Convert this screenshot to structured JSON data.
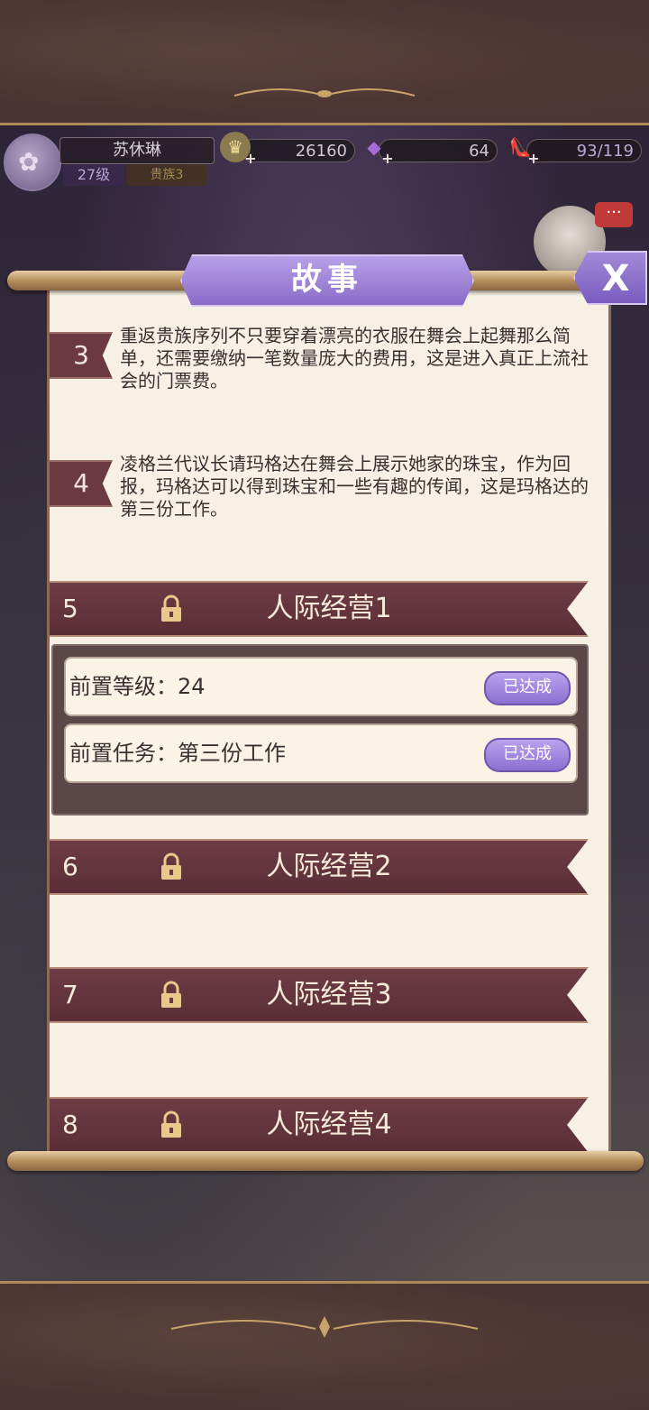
{
  "hud": {
    "player_name": "苏休琳",
    "level": "27级",
    "rank": "贵族3",
    "gold": "26160",
    "diamonds": "64",
    "stamina": "93/119"
  },
  "dialog": {
    "title": "故事",
    "close_label": "X"
  },
  "stories": [
    {
      "number": "3",
      "text": "重返贵族序列不只要穿着漂亮的衣服在舞会上起舞那么简单，还需要缴纳一笔数量庞大的费用，这是进入真正上流社会的门票费。"
    },
    {
      "number": "4",
      "text": "凌格兰代议长请玛格达在舞会上展示她家的珠宝，作为回报，玛格达可以得到珠宝和一些有趣的传闻，这是玛格达的第三份工作。"
    }
  ],
  "chapters": [
    {
      "number": "5",
      "title": "人际经营1",
      "locked": true
    },
    {
      "number": "6",
      "title": "人际经营2",
      "locked": true
    },
    {
      "number": "7",
      "title": "人际经营3",
      "locked": true
    },
    {
      "number": "8",
      "title": "人际经营4",
      "locked": true
    }
  ],
  "requirements": [
    {
      "label": "前置等级：24",
      "status": "已达成"
    },
    {
      "label": "前置任务：第三份工作",
      "status": "已达成"
    }
  ],
  "icons": {
    "gold": "crown-coin-icon",
    "diamond": "gem-icon",
    "stamina": "shoe-icon",
    "lock": "lock-icon"
  },
  "colors": {
    "accent_purple": "#8c70d2",
    "ribbon": "#5a2e36",
    "paper": "#f7f0e4"
  }
}
